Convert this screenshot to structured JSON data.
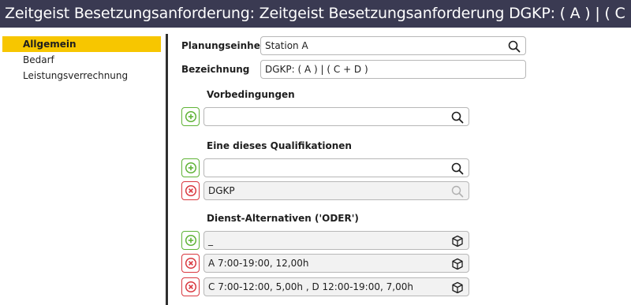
{
  "window": {
    "title": "Zeitgeist Besetzungsanforderung: Zeitgeist Besetzungsanforderung DGKP: ( A ) | ( C + D )"
  },
  "sidebar": {
    "items": [
      {
        "label": "Allgemein",
        "active": true
      },
      {
        "label": "Bedarf",
        "active": false
      },
      {
        "label": "Leistungsverrechnung",
        "active": false
      }
    ]
  },
  "form": {
    "planungseinheit": {
      "label": "Planungseinheit",
      "value": "Station A",
      "icon": "search-icon"
    },
    "bezeichnung": {
      "label": "Bezeichnung",
      "value": "DGKP: ( A ) | ( C + D )"
    },
    "vorbedingungen": {
      "heading": "Vorbedingungen",
      "add_icon": "plus-circle-icon",
      "search_value": ""
    },
    "qualifikationen": {
      "heading": "Eine dieses Qualifikationen",
      "search_value": "",
      "items": [
        {
          "value": "DGKP"
        }
      ]
    },
    "dienst_alternativen": {
      "heading": "Dienst-Alternativen ('ODER')",
      "new_value": "_",
      "items": [
        {
          "value": "A 7:00-19:00, 12,00h"
        },
        {
          "value": "C 7:00-12:00, 5,00h , D 12:00-19:00, 7,00h"
        }
      ]
    }
  },
  "colors": {
    "titlebar": "#3a3a52",
    "active_nav": "#f7c600",
    "add_green": "#5fb336",
    "remove_red": "#d9383f"
  }
}
